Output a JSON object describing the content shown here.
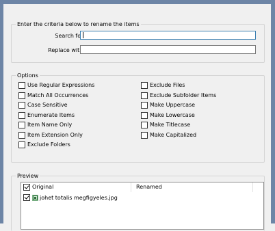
{
  "rename_group": {
    "legend": "Enter the criteria below to rename the items",
    "search_label": "Search for:",
    "search_value": "",
    "replace_label": "Replace with:",
    "replace_value": ""
  },
  "options_group": {
    "legend": "Options",
    "left": [
      {
        "label": "Use Regular Expressions",
        "checked": false
      },
      {
        "label": "Match All Occurrences",
        "checked": false
      },
      {
        "label": "Case Sensitive",
        "checked": false
      },
      {
        "label": "Enumerate Items",
        "checked": false
      },
      {
        "label": "Item Name Only",
        "checked": false
      },
      {
        "label": "Item Extension Only",
        "checked": false
      },
      {
        "label": "Exclude Folders",
        "checked": false
      }
    ],
    "right": [
      {
        "label": "Exclude Files",
        "checked": false
      },
      {
        "label": "Exclude Subfolder Items",
        "checked": false
      },
      {
        "label": "Make Uppercase",
        "checked": false
      },
      {
        "label": "Make Lowercase",
        "checked": false
      },
      {
        "label": "Make Titlecase",
        "checked": false
      },
      {
        "label": "Make Capitalized",
        "checked": false
      }
    ]
  },
  "preview_group": {
    "legend": "Preview",
    "columns": {
      "original": "Original",
      "renamed": "Renamed"
    },
    "header_checked": true,
    "rows": [
      {
        "original": "johet totalis megfigyeles.jpg",
        "renamed": "",
        "checked": true,
        "icon": "image-file-icon"
      }
    ]
  }
}
